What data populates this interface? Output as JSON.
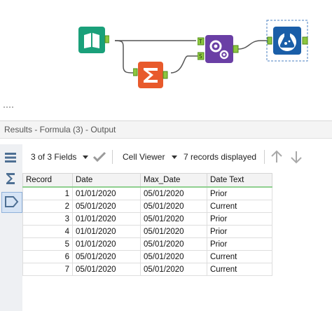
{
  "results": {
    "title": "Results - Formula (3) - Output",
    "fields_label": "3 of 3 Fields",
    "viewer_label": "Cell Viewer",
    "records_label": "7 records displayed"
  },
  "workflow": {
    "anchors": {
      "formula_t": "T",
      "formula_s": "S"
    }
  },
  "table": {
    "columns": [
      "Record",
      "Date",
      "Max_Date",
      "Date Text"
    ],
    "rows": [
      [
        "1",
        "01/01/2020",
        "05/01/2020",
        "Prior"
      ],
      [
        "2",
        "05/01/2020",
        "05/01/2020",
        "Current"
      ],
      [
        "3",
        "01/01/2020",
        "05/01/2020",
        "Prior"
      ],
      [
        "4",
        "01/01/2020",
        "05/01/2020",
        "Prior"
      ],
      [
        "5",
        "01/01/2020",
        "05/01/2020",
        "Prior"
      ],
      [
        "6",
        "05/01/2020",
        "05/01/2020",
        "Current"
      ],
      [
        "7",
        "05/01/2020",
        "05/01/2020",
        "Current"
      ]
    ]
  },
  "colors": {
    "input_tool": "#1aa07a",
    "summarize_tool": "#e85a2c",
    "formula_tool": "#6a3fa5",
    "browse_tool": "#1a5ea8",
    "anchor": "#8cc63f",
    "header_underline": "#8fcf8f"
  }
}
